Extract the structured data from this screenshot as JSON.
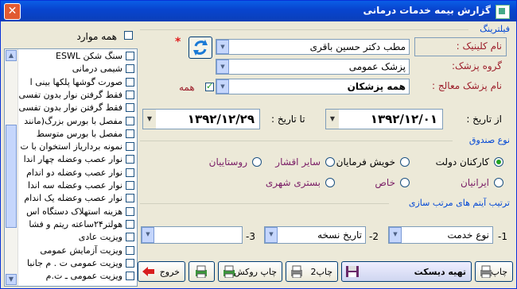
{
  "window": {
    "title": "گزارش بیمه خدمات درمانی",
    "close_symbol": "✕"
  },
  "list_panel": {
    "select_all_label": "همه موارد",
    "select_all_checked": false,
    "items": [
      "سنگ شکن ESWL",
      "شیمی درمانی",
      "صورت گوشها پلکها بینی ا",
      "فقط گرفتن نوار بدون تفسی",
      "فقط گرفتن نوار بدون تفسی",
      "مفصل با بورس بزرگ(مانند",
      "مفصل با بورس متوسط",
      "نمونه برداریاز استخوان با ت",
      "نوار عصب وعضله چهار اندا",
      "نوار عصب وعضله دو اندام",
      "نوار عصب وعضله سه اندا",
      "نوار عصب وعضله یک اندام",
      "هزینه استهلاک دستگاه اس",
      "هولتر۲۴ساعته ریتم و فشا",
      "ویزیت عادی",
      "ویزیت آزمایش عمومی",
      "ویزیت عمومی ت . م جانبا",
      "ویزیت عمومی ـ ت.م"
    ]
  },
  "filtering": {
    "group_title": "فیلترینگ",
    "clinic_label": "نام کلینیک :",
    "clinic_value": "مطب دکتر حسین باقری",
    "doctor_group_label": "گروه پزشک:",
    "doctor_group_value": "پزشک عمومی",
    "treating_doctor_label": "نام پزشک معالج :",
    "treating_doctor_value": "همه پزشکان",
    "all_label": "همه",
    "all_checked": true,
    "required_mark": "*",
    "refresh_icon": "refresh-icon"
  },
  "dates": {
    "from_label": "از تاریخ :",
    "from_value": "۱۳۹۲/۱۲/۰۱",
    "to_label": "تا تاریخ :",
    "to_value": "۱۳۹۲/۱۲/۲۹"
  },
  "fund_type": {
    "group_title": "نوع صندوق",
    "options": [
      {
        "label": "کارکنان دولت",
        "selected": true
      },
      {
        "label": "خویش فرمایان",
        "selected": false
      },
      {
        "label": "سایر اقشار",
        "selected": false
      },
      {
        "label": "روستاییان",
        "selected": false
      },
      {
        "label": "ایرانیان",
        "selected": false
      },
      {
        "label": "خاص",
        "selected": false
      },
      {
        "label": "بستری شهری",
        "selected": false
      }
    ]
  },
  "sort": {
    "group_title": "ترتیب آیتم های مرتب سازی",
    "num1": "1-",
    "value1": "نوع خدمت",
    "num2": "2-",
    "value2": "تاریخ نسخه",
    "num3": "3-",
    "value3": ""
  },
  "buttons": {
    "print": "چاپ",
    "prepare_disk": "تهیه دیسکت",
    "print2": "چاپ2",
    "print_cover": "چاپ روکش",
    "exit": "خروج"
  },
  "colors": {
    "title_bar": "#0a5ee6",
    "group_title": "#0046d5",
    "label_red": "#9d1f2b",
    "radio_purple": "#7a1e66"
  }
}
